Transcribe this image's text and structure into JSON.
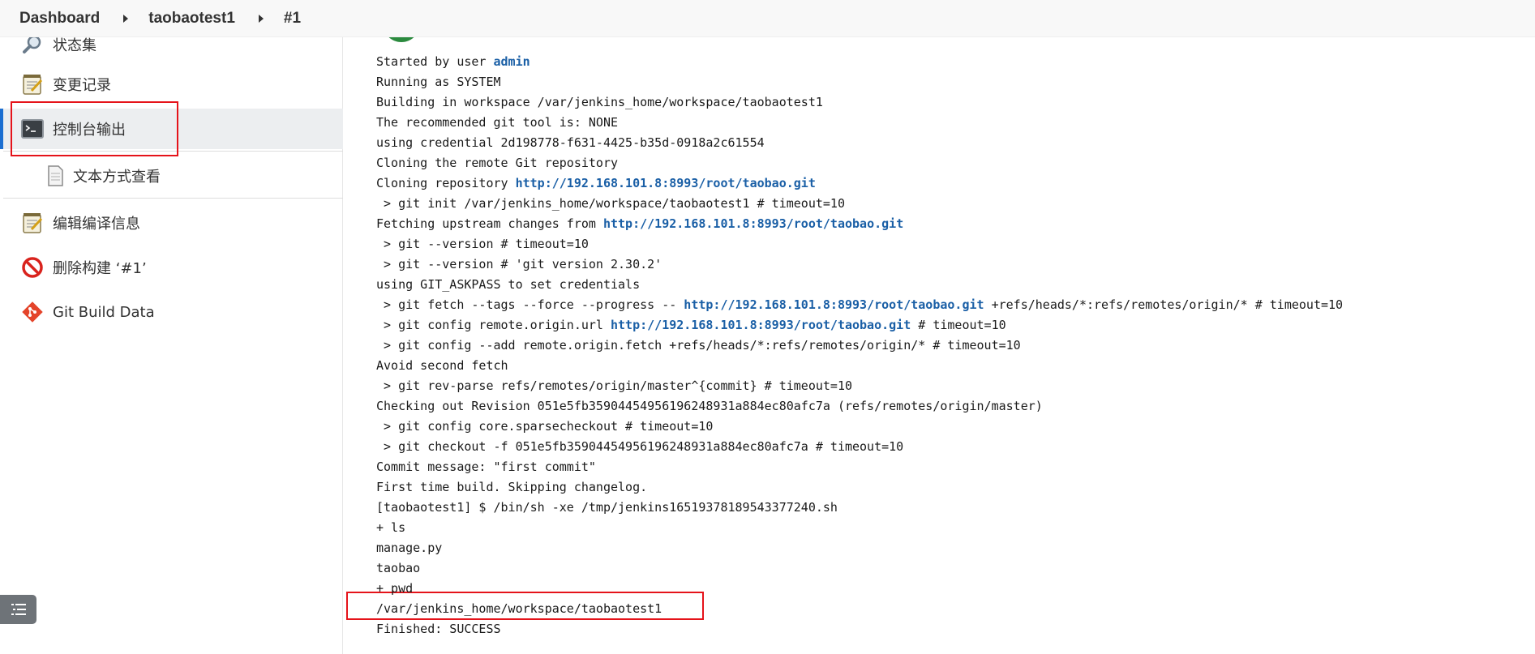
{
  "breadcrumb": [
    "Dashboard",
    "taobaotest1",
    "#1"
  ],
  "sidebar": {
    "items": [
      {
        "label": "状态集",
        "icon": "search-icon"
      },
      {
        "label": "变更记录",
        "icon": "notepad-icon"
      },
      {
        "label": "控制台输出",
        "icon": "terminal-icon"
      },
      {
        "label": "文本方式查看",
        "icon": "document-icon"
      },
      {
        "label": "编辑编译信息",
        "icon": "notepad-icon"
      },
      {
        "label": "删除构建 ‘#1’",
        "icon": "no-entry-icon"
      },
      {
        "label": "Git Build Data",
        "icon": "git-icon"
      }
    ]
  },
  "console": {
    "started_prefix": "Started by user ",
    "started_user": "admin",
    "lines_a": [
      "Running as SYSTEM",
      "Building in workspace /var/jenkins_home/workspace/taobaotest1",
      "The recommended git tool is: NONE",
      "using credential 2d198778-f631-4425-b35d-0918a2c61554",
      "Cloning the remote Git repository"
    ],
    "cloning_prefix": "Cloning repository ",
    "repo_url": "http://192.168.101.8:8993/root/taobao.git",
    "git_init": " > git init /var/jenkins_home/workspace/taobaotest1 # timeout=10",
    "fetching_prefix": "Fetching upstream changes from ",
    "lines_b": [
      " > git --version # timeout=10",
      " > git --version # 'git version 2.30.2'",
      "using GIT_ASKPASS to set credentials"
    ],
    "fetch_prefix": " > git fetch --tags --force --progress -- ",
    "fetch_suffix": " +refs/heads/*:refs/remotes/origin/* # timeout=10",
    "config_prefix": " > git config remote.origin.url ",
    "config_suffix": " # timeout=10",
    "lines_c": [
      " > git config --add remote.origin.fetch +refs/heads/*:refs/remotes/origin/* # timeout=10",
      "Avoid second fetch",
      " > git rev-parse refs/remotes/origin/master^{commit} # timeout=10",
      "Checking out Revision 051e5fb35904454956196248931a884ec80afc7a (refs/remotes/origin/master)",
      " > git config core.sparsecheckout # timeout=10",
      " > git checkout -f 051e5fb35904454956196248931a884ec80afc7a # timeout=10",
      "Commit message: \"first commit\"",
      "First time build. Skipping changelog.",
      "[taobaotest1] $ /bin/sh -xe /tmp/jenkins16519378189543377240.sh",
      "+ ls",
      "manage.py",
      "taobao",
      "+ pwd",
      "/var/jenkins_home/workspace/taobaotest1",
      "Finished: SUCCESS"
    ]
  },
  "colors": {
    "link": "#1a5fa6",
    "highlight": "#e5131a",
    "active_bar": "#1d6fd1",
    "success": "#2b8a3e"
  }
}
